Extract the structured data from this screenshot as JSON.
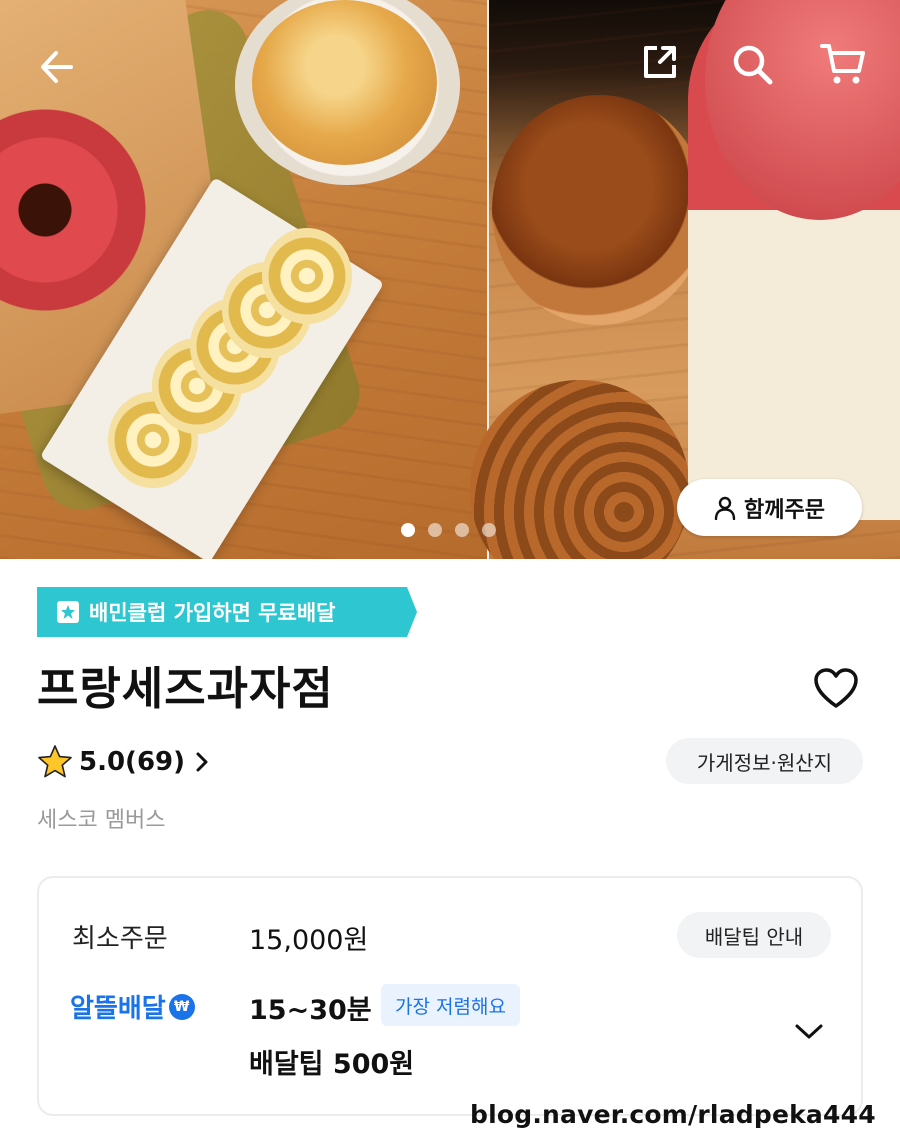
{
  "hero": {
    "left_photo_alt": "",
    "right_photo_alt": "",
    "carousel_pages": 4,
    "carousel_active_index": 0,
    "group_order_label": "함께주문"
  },
  "header_icons": {
    "back": "back-arrow-icon",
    "share": "share-icon",
    "search": "search-icon",
    "cart": "cart-icon"
  },
  "promo": {
    "label": "배민클럽 가입하면 무료배달",
    "color": "#2ec7d1"
  },
  "store": {
    "name": "프랑세즈과자점",
    "rating": "5.0(69)",
    "brand": "세스코 멤버스",
    "info_button": "가게정보·원산지"
  },
  "delivery": {
    "min_order_label": "최소주문",
    "min_order_value": "15,000원",
    "tip_guide_button": "배달팁 안내",
    "saver_label": "알뜰배달",
    "saver_coin": "₩",
    "time": "15~30분",
    "cheapest_tag": "가장 저렴해요",
    "tip": "배달팁 500원",
    "accent_color": "#1a73e8"
  },
  "watermark": "blog.naver.com/rladpeka444"
}
